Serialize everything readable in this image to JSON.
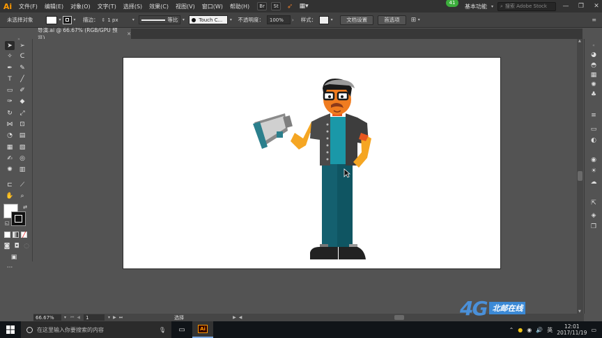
{
  "app": {
    "logo": "Ai"
  },
  "menu": [
    "文件(F)",
    "编辑(E)",
    "对象(O)",
    "文字(T)",
    "选择(S)",
    "效果(C)",
    "视图(V)",
    "窗口(W)",
    "帮助(H)"
  ],
  "menubar_right": {
    "notification_count": "41",
    "workspace": "基本功能",
    "stock_search_placeholder": "搜索 Adobe Stock",
    "minimize": "—",
    "restore": "❐",
    "close": "✕"
  },
  "control": {
    "no_selection": "未选择对象",
    "stroke_label": "描边：",
    "stroke_value": "1 px",
    "stroke_style": "等比",
    "brush_name": "Touch C...",
    "opacity_label": "不透明度：",
    "opacity_value": "100%",
    "style_label": "样式：",
    "doc_setup": "文档设置",
    "prefs": "首选项"
  },
  "tab": {
    "title": "导演.ai @ 66.67% (RGB/GPU 预览)",
    "close": "✕"
  },
  "status": {
    "zoom": "66.67%",
    "page": "1",
    "mode": "选择"
  },
  "taskbar": {
    "search_placeholder": "在这里输入你要搜索的内容",
    "lang": "英",
    "time": "12:01",
    "date": "2017/11/19"
  },
  "watermark": {
    "logo": "4G",
    "text": "北邮在线"
  },
  "colors": {
    "accent": "#ff9a00",
    "artboard": "#ffffff",
    "teal_shirt": "#1a98a8",
    "pants": "#14606f",
    "skin": "#f5a623",
    "vest": "#4a4a4a"
  }
}
